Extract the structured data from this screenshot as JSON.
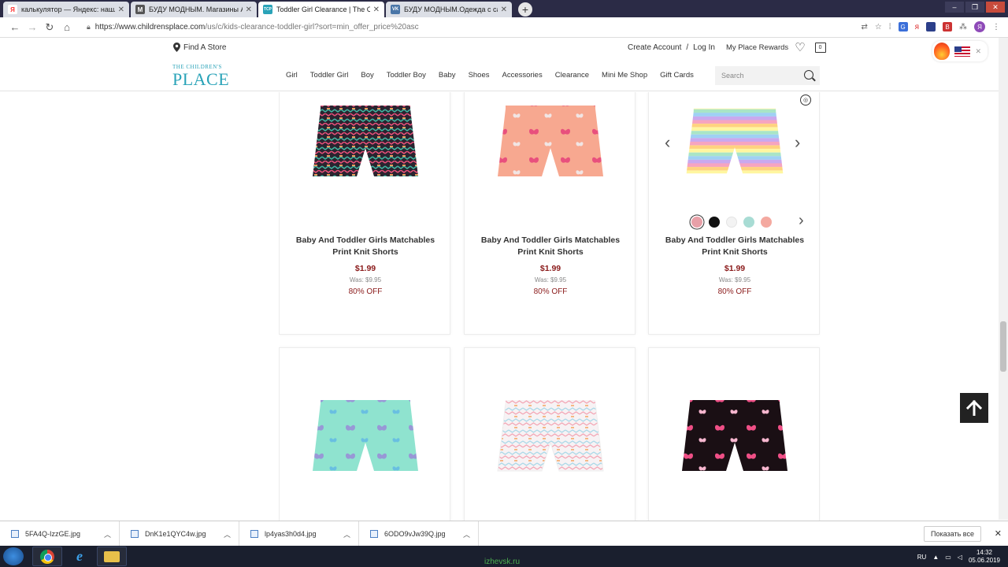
{
  "browser": {
    "tabs": [
      {
        "label": "калькулятор — Яндекс: нашлось",
        "favicon": "Я",
        "color": "#ff3333",
        "active": false
      },
      {
        "label": "БУДУ МОДНЫМ. Магазины Аме",
        "favicon": "М",
        "color": "#555555",
        "active": false
      },
      {
        "label": "Toddler Girl Clearance | The Chil",
        "favicon": "TCP",
        "color": "#2aa3b8",
        "active": true
      },
      {
        "label": "БУДУ МОДНЫМ.Одежда с сайт",
        "favicon": "VK",
        "color": "#4a76a8",
        "active": false
      }
    ],
    "url_main": "https://www.childrensplace.com",
    "url_rest": "/us/c/kids-clearance-toddler-girl?sort=min_offer_price%20asc",
    "profile_initial": "Я"
  },
  "header": {
    "find_store": "Find A Store",
    "create_account": "Create Account",
    "separator": "/",
    "login": "Log In",
    "rewards": "My Place Rewards",
    "bag_count": "0",
    "logo_small": "THE CHILDREN'S",
    "logo_big": "PLACE",
    "nav": [
      "Girl",
      "Toddler Girl",
      "Boy",
      "Toddler Boy",
      "Baby",
      "Shoes",
      "Accessories",
      "Clearance",
      "Mini Me Shop",
      "Gift Cards"
    ],
    "search_placeholder": "Search"
  },
  "products": [
    {
      "title": "Baby And Toddler Girls Matchables Print Knit Shorts",
      "price": "$1.99",
      "was": "Was: $9.95",
      "off": "80% OFF",
      "pattern": "tribal"
    },
    {
      "title": "Baby And Toddler Girls Matchables Print Knit Shorts",
      "price": "$1.99",
      "was": "Was: $9.95",
      "off": "80% OFF",
      "pattern": "butterfly-coral"
    },
    {
      "title": "Baby And Toddler Girls Matchables Print Knit Shorts",
      "price": "$1.99",
      "was": "Was: $9.95",
      "off": "80% OFF",
      "pattern": "rainbow-stripe"
    },
    {
      "pattern": "butterfly-mint"
    },
    {
      "pattern": "pastel-aztec"
    },
    {
      "pattern": "butterfly-black"
    }
  ],
  "swatch_colors": [
    "#e8a0a8",
    "#111111",
    "#f3f3f3",
    "#a8dcd4",
    "#f4a9a0"
  ],
  "downloads": {
    "files": [
      "5FA4Q-IzzGE.jpg",
      "DnK1e1QYC4w.jpg",
      "lp4yas3h0d4.jpg",
      "6ODO9vJw39Q.jpg"
    ],
    "show_all": "Показать все"
  },
  "taskbar": {
    "lang": "RU",
    "time": "14:32",
    "date": "05.06.2019",
    "watermark": "izhevsk.ru"
  }
}
